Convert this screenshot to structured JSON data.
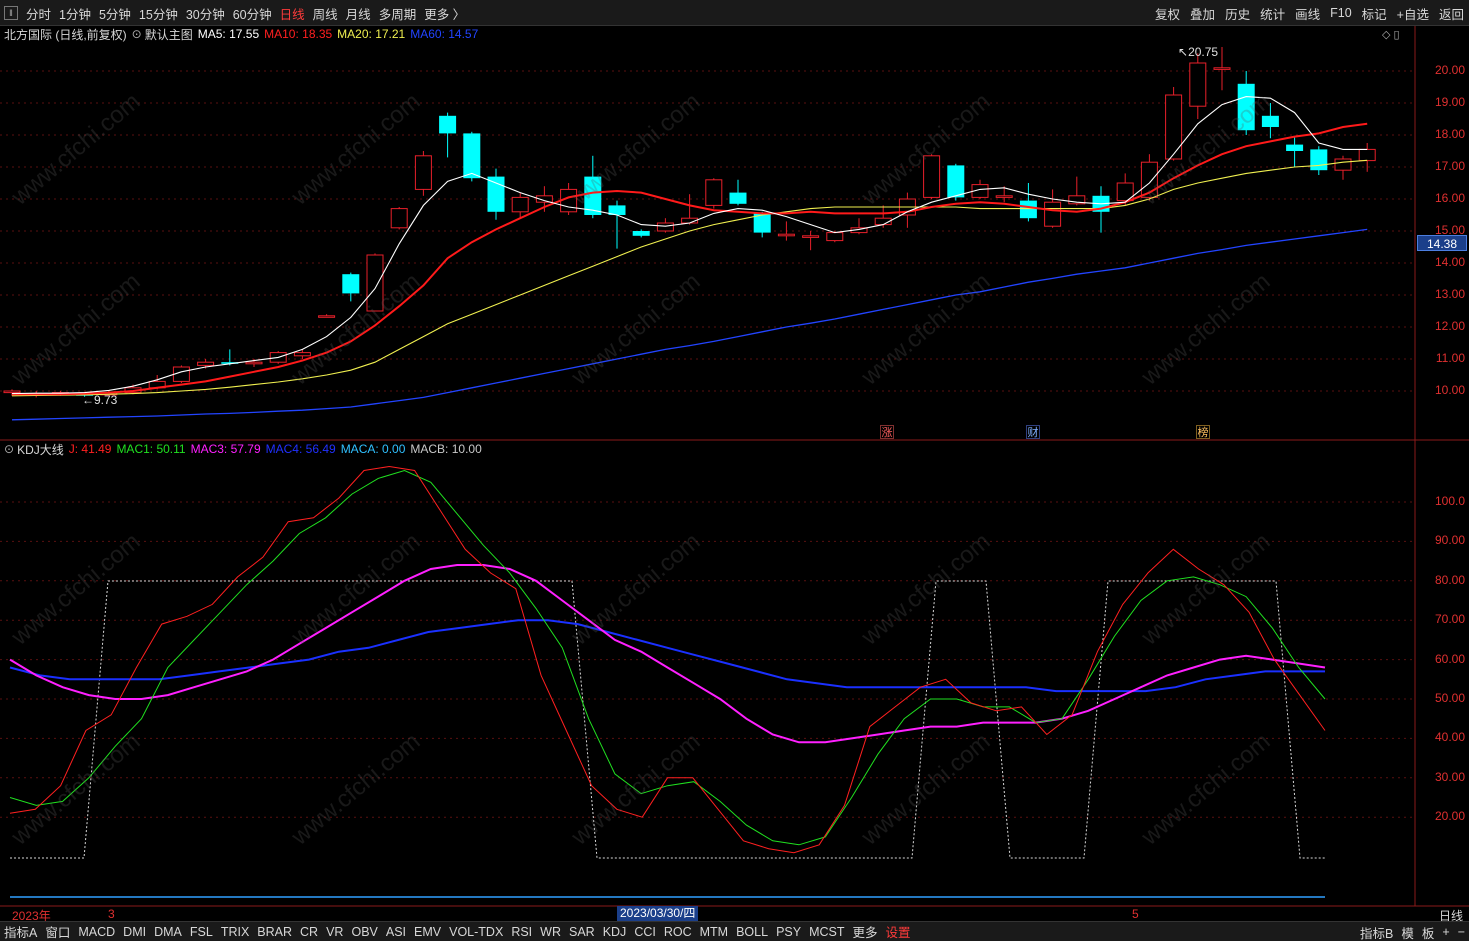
{
  "toolbar": {
    "periods": [
      "分时",
      "1分钟",
      "5分钟",
      "15分钟",
      "30分钟",
      "60分钟",
      "日线",
      "周线",
      "月线",
      "多周期",
      "更多 〉"
    ],
    "active_period": "日线",
    "right_buttons": [
      "复权",
      "叠加",
      "历史",
      "统计",
      "画线",
      "F10",
      "标记",
      "+自选",
      "返回"
    ]
  },
  "main_info": {
    "title": "北方国际 (日线,前复权)",
    "template": "默认主图",
    "ma5": "MA5: 17.55",
    "ma10": "MA10: 18.35",
    "ma20": "MA20: 17.21",
    "ma60": "MA60: 14.57"
  },
  "price_axis": {
    "labels": [
      "20.00",
      "19.00",
      "18.00",
      "17.00",
      "16.00",
      "15.00",
      "14.00",
      "13.00",
      "12.00",
      "11.00",
      "10.00"
    ],
    "current": "14.38"
  },
  "annotations": {
    "high": "20.75",
    "low": "9.73",
    "markers": [
      "涨",
      "财",
      "榜"
    ]
  },
  "kdj_info": {
    "title": "KDJ大线",
    "j": "J: 41.49",
    "mac1": "MAC1: 50.11",
    "mac3": "MAC3: 57.79",
    "mac4": "MAC4: 56.49",
    "maca": "MACA: 0.00",
    "macb": "MACB: 10.00"
  },
  "kdj_axis": {
    "labels": [
      "100.0",
      "90.00",
      "80.00",
      "70.00",
      "60.00",
      "50.00",
      "40.00",
      "30.00",
      "20.00"
    ]
  },
  "date_axis": {
    "year": "2023年",
    "m3": "3",
    "cursor": "2023/03/30/四",
    "m5": "5",
    "period": "日线"
  },
  "bottom_tabs": [
    "指标A",
    "窗口",
    "MACD",
    "DMI",
    "DMA",
    "FSL",
    "TRIX",
    "BRAR",
    "CR",
    "VR",
    "OBV",
    "ASI",
    "EMV",
    "VOL-TDX",
    "RSI",
    "WR",
    "SAR",
    "KDJ",
    "CCI",
    "ROC",
    "MTM",
    "BOLL",
    "PSY",
    "MCST",
    "更多",
    "设置"
  ],
  "bottom_right": [
    "指标B",
    "模",
    "板",
    "+",
    "−"
  ],
  "watermark": "www.cfchi.com",
  "colors": {
    "up": "#e8202a",
    "down": "#00ffff",
    "ma5": "#ffffff",
    "ma10": "#ff1a1a",
    "ma20": "#f0f050",
    "ma60": "#2244ff",
    "k": "#ff2020",
    "d": "#20e020",
    "mac3": "#ff20ff",
    "mac4": "#1a30ff"
  },
  "chart_data": {
    "type": "candlestick",
    "candles": [
      [
        9.95,
        10.0,
        10.05,
        9.85
      ],
      [
        9.9,
        9.92,
        10.0,
        9.8
      ],
      [
        9.92,
        9.95,
        10.0,
        9.85
      ],
      [
        9.9,
        9.88,
        9.95,
        9.82
      ],
      [
        9.88,
        9.95,
        10.0,
        9.85
      ],
      [
        9.95,
        10.1,
        10.2,
        9.9
      ],
      [
        10.1,
        10.3,
        10.5,
        10.05
      ],
      [
        10.3,
        10.75,
        10.8,
        10.25
      ],
      [
        10.8,
        10.9,
        11.0,
        10.7
      ],
      [
        10.9,
        10.85,
        11.3,
        10.8
      ],
      [
        10.85,
        10.9,
        11.0,
        10.75
      ],
      [
        10.9,
        11.2,
        11.25,
        10.85
      ],
      [
        11.1,
        11.2,
        11.3,
        11.0
      ],
      [
        12.35,
        12.35,
        12.4,
        12.3
      ],
      [
        13.65,
        13.05,
        13.7,
        12.8
      ],
      [
        12.5,
        14.25,
        14.3,
        12.5
      ],
      [
        15.1,
        15.7,
        15.75,
        15.05
      ],
      [
        16.3,
        17.35,
        17.5,
        16.1
      ],
      [
        18.6,
        18.05,
        18.7,
        17.3
      ],
      [
        18.05,
        16.65,
        18.1,
        16.55
      ],
      [
        16.7,
        15.6,
        16.95,
        15.35
      ],
      [
        15.6,
        16.05,
        16.2,
        15.4
      ],
      [
        15.9,
        16.1,
        16.4,
        15.6
      ],
      [
        15.6,
        16.3,
        16.5,
        15.5
      ],
      [
        16.7,
        15.5,
        17.35,
        15.4
      ],
      [
        15.8,
        15.5,
        15.95,
        14.45
      ],
      [
        15.0,
        14.85,
        15.05,
        14.8
      ],
      [
        15.0,
        15.25,
        15.4,
        14.95
      ],
      [
        15.25,
        15.4,
        16.15,
        15.2
      ],
      [
        15.8,
        16.6,
        16.65,
        15.7
      ],
      [
        16.2,
        15.85,
        16.6,
        15.8
      ],
      [
        15.55,
        14.95,
        15.6,
        14.8
      ],
      [
        14.85,
        14.9,
        15.3,
        14.7
      ],
      [
        14.8,
        14.85,
        15.0,
        14.4
      ],
      [
        14.7,
        14.95,
        15.0,
        14.65
      ],
      [
        14.95,
        15.1,
        15.4,
        14.9
      ],
      [
        15.2,
        15.4,
        15.8,
        15.1
      ],
      [
        15.5,
        16.0,
        16.2,
        15.1
      ],
      [
        16.05,
        17.35,
        17.4,
        16.0
      ],
      [
        17.05,
        16.05,
        17.1,
        15.95
      ],
      [
        16.05,
        16.45,
        16.6,
        16.0
      ],
      [
        16.05,
        16.1,
        16.4,
        15.9
      ],
      [
        15.95,
        15.4,
        16.5,
        15.3
      ],
      [
        15.15,
        15.9,
        16.3,
        15.1
      ],
      [
        15.85,
        16.1,
        16.7,
        15.8
      ],
      [
        16.1,
        15.6,
        16.4,
        14.95
      ],
      [
        15.95,
        16.5,
        16.8,
        15.8
      ],
      [
        16.05,
        17.15,
        17.4,
        15.95
      ],
      [
        17.25,
        19.25,
        19.5,
        17.2
      ],
      [
        18.9,
        20.25,
        20.55,
        18.5
      ],
      [
        20.05,
        20.1,
        20.75,
        19.4
      ],
      [
        19.6,
        18.15,
        20.0,
        18.0
      ],
      [
        18.6,
        18.25,
        19.0,
        17.9
      ],
      [
        17.7,
        17.5,
        17.95,
        17.0
      ],
      [
        17.55,
        16.9,
        17.65,
        16.75
      ],
      [
        16.9,
        17.25,
        17.35,
        16.6
      ],
      [
        17.2,
        17.55,
        17.75,
        16.85
      ]
    ],
    "ma5": [
      9.92,
      9.93,
      9.93,
      9.95,
      10.02,
      10.15,
      10.35,
      10.6,
      10.75,
      10.85,
      10.95,
      11.05,
      11.3,
      11.7,
      12.3,
      13.2,
      14.6,
      15.8,
      16.55,
      16.8,
      16.5,
      16.2,
      15.95,
      15.75,
      15.65,
      15.5,
      15.2,
      15.15,
      15.25,
      15.55,
      15.7,
      15.65,
      15.45,
      15.2,
      14.95,
      15.05,
      15.2,
      15.6,
      15.9,
      16.1,
      16.3,
      16.35,
      16.15,
      16.0,
      15.9,
      15.85,
      15.9,
      16.5,
      17.4,
      18.35,
      18.95,
      19.2,
      19.15,
      18.7,
      17.75,
      17.55,
      17.55
    ],
    "ma10": [
      9.9,
      9.9,
      9.9,
      9.92,
      9.95,
      10.0,
      10.1,
      10.2,
      10.3,
      10.45,
      10.6,
      10.75,
      10.95,
      11.2,
      11.55,
      12.05,
      12.65,
      13.3,
      14.15,
      14.65,
      15.05,
      15.4,
      15.75,
      16.05,
      16.2,
      16.25,
      16.2,
      16.0,
      15.8,
      15.65,
      15.6,
      15.55,
      15.55,
      15.6,
      15.55,
      15.55,
      15.55,
      15.6,
      15.75,
      15.85,
      15.9,
      15.85,
      15.75,
      15.65,
      15.6,
      15.7,
      15.9,
      16.2,
      16.65,
      17.05,
      17.4,
      17.65,
      17.8,
      17.95,
      18.05,
      18.25,
      18.35
    ],
    "ma20": [
      9.85,
      9.86,
      9.87,
      9.88,
      9.9,
      9.92,
      9.95,
      10.0,
      10.05,
      10.12,
      10.2,
      10.28,
      10.38,
      10.5,
      10.65,
      10.9,
      11.3,
      11.7,
      12.1,
      12.4,
      12.7,
      13.0,
      13.3,
      13.6,
      13.9,
      14.2,
      14.5,
      14.75,
      15.0,
      15.2,
      15.35,
      15.5,
      15.6,
      15.7,
      15.75,
      15.75,
      15.75,
      15.75,
      15.75,
      15.75,
      15.7,
      15.7,
      15.7,
      15.7,
      15.7,
      15.7,
      15.8,
      16.0,
      16.3,
      16.5,
      16.65,
      16.8,
      16.9,
      17.0,
      17.05,
      17.15,
      17.21
    ],
    "ma60": [
      9.1,
      9.12,
      9.14,
      9.16,
      9.18,
      9.2,
      9.22,
      9.25,
      9.28,
      9.3,
      9.33,
      9.37,
      9.4,
      9.45,
      9.5,
      9.6,
      9.7,
      9.8,
      9.95,
      10.1,
      10.25,
      10.4,
      10.55,
      10.7,
      10.85,
      11.0,
      11.15,
      11.3,
      11.42,
      11.55,
      11.7,
      11.85,
      12.0,
      12.12,
      12.25,
      12.4,
      12.55,
      12.7,
      12.85,
      13.0,
      13.1,
      13.25,
      13.4,
      13.52,
      13.65,
      13.75,
      13.85,
      14.0,
      14.15,
      14.3,
      14.42,
      14.55,
      14.65,
      14.75,
      14.85,
      14.95,
      15.05
    ],
    "kdj_k": [
      21,
      22,
      28,
      42,
      46,
      58,
      69,
      71,
      74,
      81,
      86,
      95,
      96,
      101,
      108,
      109,
      108,
      98,
      88,
      82,
      78,
      56,
      42,
      28,
      22,
      20,
      30,
      30,
      22,
      14,
      12,
      11,
      13,
      23,
      43,
      48,
      53,
      55,
      49,
      47,
      48,
      41,
      46,
      62,
      74,
      82,
      88,
      83,
      79,
      72,
      60,
      51,
      42
    ],
    "kdj_d": [
      25,
      23,
      24,
      30,
      38,
      45,
      58,
      65,
      72,
      79,
      85,
      92,
      96,
      102,
      106,
      108,
      105,
      97,
      89,
      82,
      73,
      63,
      45,
      31,
      26,
      28,
      29,
      24,
      18,
      14,
      13,
      15,
      25,
      36,
      45,
      50,
      50,
      48,
      48,
      44,
      45,
      55,
      66,
      75,
      80,
      81,
      79,
      76,
      68,
      58,
      50
    ],
    "mac3": [
      60,
      56,
      53,
      51,
      50,
      50,
      51,
      53,
      55,
      57,
      60,
      64,
      68,
      72,
      76,
      80,
      83,
      84,
      84,
      83,
      80,
      75,
      70,
      65,
      62,
      58,
      54,
      50,
      45,
      41,
      39,
      39,
      40,
      41,
      42,
      43,
      43,
      44,
      44,
      44,
      45,
      47,
      50,
      53,
      56,
      58,
      60,
      61,
      60,
      59,
      58
    ],
    "mac4": [
      58,
      56,
      55,
      55,
      55,
      55,
      56,
      57,
      58,
      59,
      60,
      62,
      63,
      65,
      67,
      68,
      69,
      70,
      70,
      69,
      67,
      65,
      63,
      61,
      59,
      57,
      55,
      54,
      53,
      53,
      53,
      53,
      53,
      53,
      53,
      52,
      52,
      52,
      52,
      53,
      55,
      56,
      57,
      57,
      57
    ]
  }
}
